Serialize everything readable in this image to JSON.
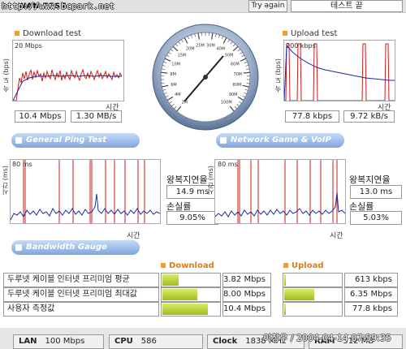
{
  "header": {
    "url": "http://www.bcpark.net",
    "wan_tab": "WAN TEST",
    "try_again": "Try again",
    "test_end": "테스트 끝"
  },
  "download": {
    "title": "Download test",
    "scale": "20 Mbps",
    "yaxis": "속 도 (bps)",
    "xaxis": "시간",
    "value_mbps": "10.4 Mbps",
    "value_mbs": "1.30 MB/s"
  },
  "upload": {
    "title": "Upload test",
    "scale": "200 kbps",
    "yaxis": "속 도 (bps)",
    "xaxis": "시간",
    "value_kbps": "77.8 kbps",
    "value_kbs": "9.72 kB/s"
  },
  "gauge": {
    "labels": [
      "2M",
      "4M",
      "6M",
      "8M",
      "10M",
      "15M",
      "20M",
      "25M",
      "30M",
      "40M",
      "50M",
      "60M",
      "70M",
      "80M",
      "90M",
      "100M"
    ],
    "needle_value": "10.4"
  },
  "ping": {
    "title": "General Ping Test",
    "scale": "80 ms",
    "yaxis": "시간 (ms)",
    "xaxis": "시간",
    "rtt_label": "왕복지연율",
    "rtt_value": "14.9 ms",
    "loss_label": "손실률",
    "loss_value": "9.05%"
  },
  "game": {
    "title": "Network Game & VoIP Test",
    "scale": "80 ms",
    "yaxis": "시간 (ms)",
    "xaxis": "시간",
    "rtt_label": "왕복지연율",
    "rtt_value": "13.0 ms",
    "loss_label": "손실률",
    "loss_value": "5.03%"
  },
  "bandwidth": {
    "title": "Bandwidth Gauge",
    "download_head": "Download",
    "upload_head": "Upload",
    "rows": [
      {
        "label": "두루넷 케이블 인터넷 프리미엄 평균",
        "down": "3.82 Mbps",
        "down_frac": 0.28,
        "up": "613 kbps",
        "up_frac": 0.03
      },
      {
        "label": "두루넷 케이블 인터넷 프리미엄 최대값",
        "down": "8.00 Mbps",
        "down_frac": 0.6,
        "up": "6.35 Mbps",
        "up_frac": 0.52
      },
      {
        "label": "사용자 측정값",
        "down": "10.4 Mbps",
        "down_frac": 0.78,
        "up": "77.8 kbps",
        "up_frac": 0.02
      }
    ]
  },
  "status": {
    "lan_label": "LAN",
    "lan_value": "100 Mbps",
    "cpu_label": "CPU",
    "cpu_value": "586",
    "clock_label": "Clock",
    "clock_value": "1838 MHz",
    "ram_label": "RAM",
    "ram_value": "512 MB"
  },
  "watermark": "이창우 / 2004-04-14 07:59:35",
  "colors": {
    "accent_orange": "#f39c2c",
    "line_red": "#c81e1e",
    "line_blue": "#1a2a9a",
    "bar_green": "#a9c526",
    "section_blue": "#7fa6df"
  }
}
